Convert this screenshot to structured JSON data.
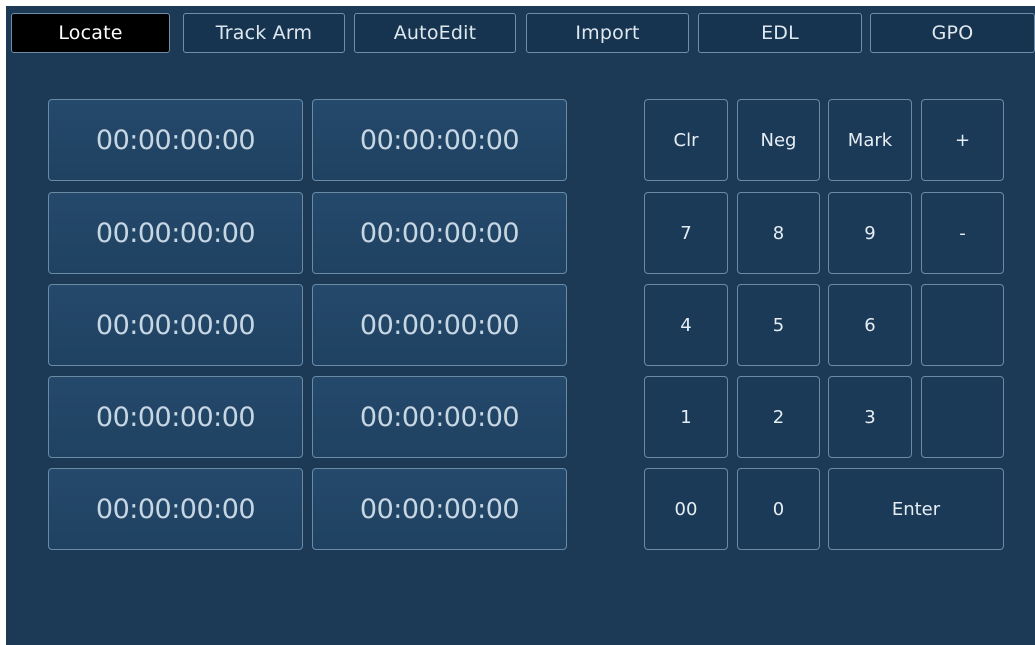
{
  "tabs": [
    {
      "label": "Locate",
      "active": true
    },
    {
      "label": "Track Arm",
      "active": false
    },
    {
      "label": "AutoEdit",
      "active": false
    },
    {
      "label": "Import",
      "active": false
    },
    {
      "label": "EDL",
      "active": false
    },
    {
      "label": "GPO",
      "active": false
    }
  ],
  "timecodes": [
    [
      "00:00:00:00",
      "00:00:00:00"
    ],
    [
      "00:00:00:00",
      "00:00:00:00"
    ],
    [
      "00:00:00:00",
      "00:00:00:00"
    ],
    [
      "00:00:00:00",
      "00:00:00:00"
    ],
    [
      "00:00:00:00",
      "00:00:00:00"
    ]
  ],
  "keypad": {
    "clr": "Clr",
    "neg": "Neg",
    "mark": "Mark",
    "plus": "+",
    "seven": "7",
    "eight": "8",
    "nine": "9",
    "minus": "-",
    "four": "4",
    "five": "5",
    "six": "6",
    "blank_row3": "",
    "one": "1",
    "two": "2",
    "three": "3",
    "blank_row4": "",
    "double_zero": "00",
    "zero": "0",
    "enter": "Enter"
  },
  "colors": {
    "background": "#1c3a56",
    "active_tab": "#000000",
    "border": "#6a8aa6"
  }
}
